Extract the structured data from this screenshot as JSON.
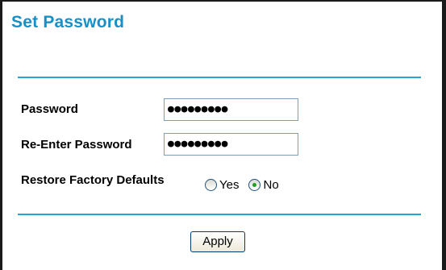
{
  "page": {
    "title": "Set Password"
  },
  "form": {
    "password_label": "Password",
    "password_value": "●●●●●●●●●",
    "reenter_label": "Re-Enter Password",
    "reenter_value": "●●●●●●●●●",
    "restore_label": "Restore Factory Defaults",
    "restore_options": {
      "yes_label": "Yes",
      "no_label": "No",
      "selected": "No"
    }
  },
  "actions": {
    "apply_label": "Apply"
  },
  "colors": {
    "accent": "#1a8fc6",
    "rule": "#27a3d6",
    "radio_selected": "#21a121"
  }
}
